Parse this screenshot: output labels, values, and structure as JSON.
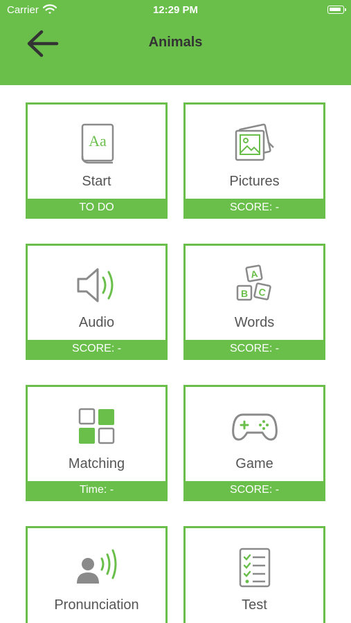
{
  "status_bar": {
    "carrier": "Carrier",
    "time": "12:29 PM"
  },
  "header": {
    "title": "Animals"
  },
  "colors": {
    "accent": "#6abf4b",
    "icon_gray": "#8a8a8a",
    "text": "#555555"
  },
  "cards": [
    {
      "label": "Start",
      "status": "TO DO",
      "icon": "book-icon"
    },
    {
      "label": "Pictures",
      "status": "SCORE: -",
      "icon": "pictures-icon"
    },
    {
      "label": "Audio",
      "status": "SCORE: -",
      "icon": "speaker-icon"
    },
    {
      "label": "Words",
      "status": "SCORE: -",
      "icon": "letter-blocks-icon"
    },
    {
      "label": "Matching",
      "status": "Time: -",
      "icon": "grid-icon"
    },
    {
      "label": "Game",
      "status": "SCORE: -",
      "icon": "gamepad-icon"
    },
    {
      "label": "Pronunciation",
      "status": "",
      "icon": "speaking-person-icon"
    },
    {
      "label": "Test",
      "status": "",
      "icon": "checklist-icon"
    }
  ],
  "icon_text": {
    "book": "Aa",
    "block_a": "A",
    "block_b": "B",
    "block_c": "C"
  }
}
